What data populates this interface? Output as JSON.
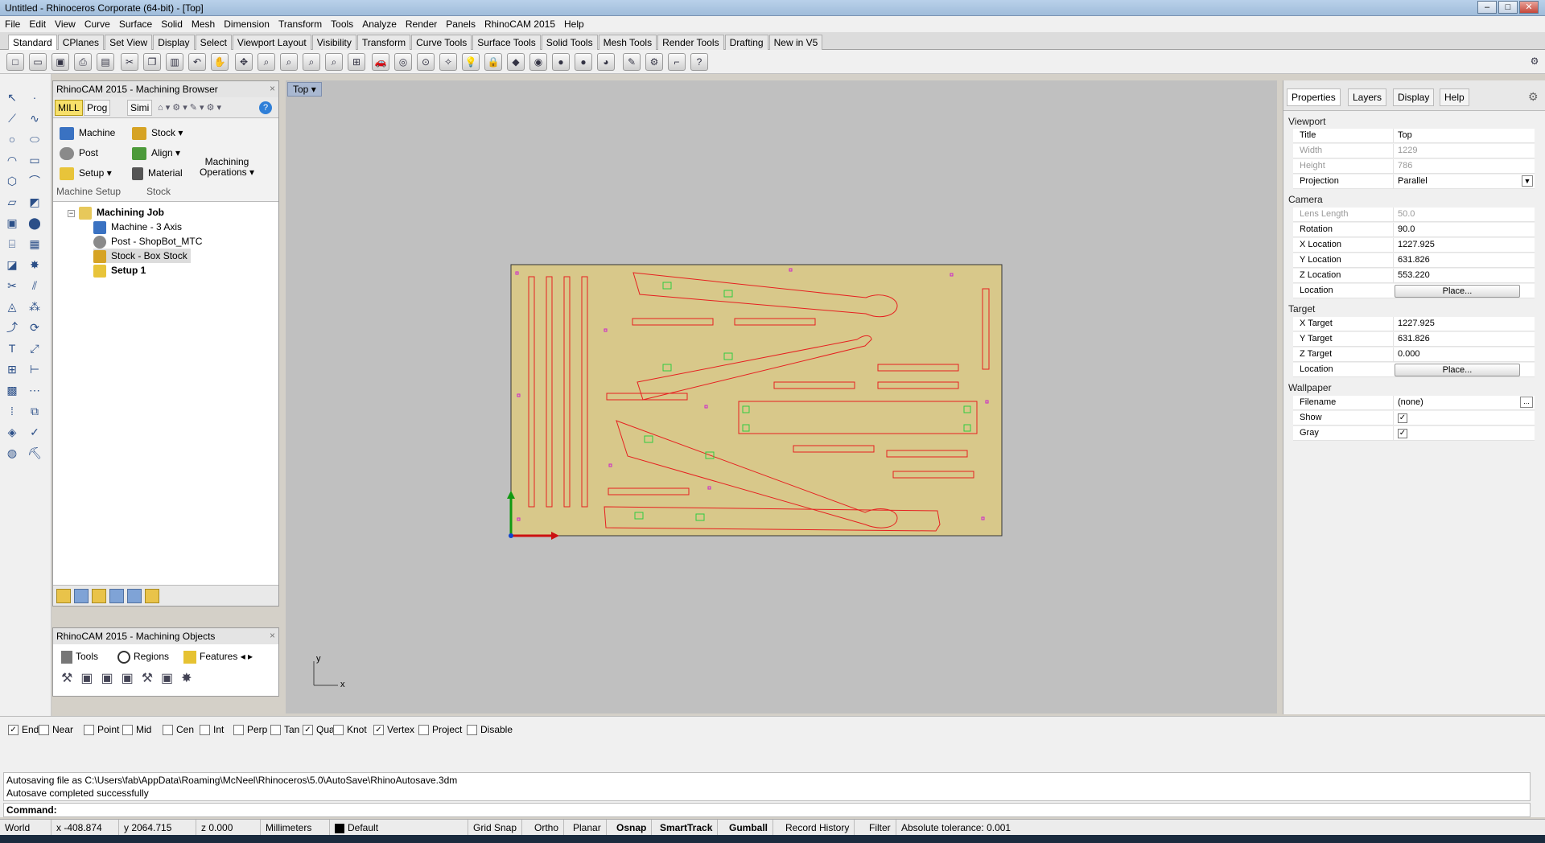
{
  "window": {
    "title": "Untitled - Rhinoceros Corporate (64-bit) - [Top]",
    "controls": [
      "–",
      "□",
      "✕"
    ]
  },
  "menu": [
    "File",
    "Edit",
    "View",
    "Curve",
    "Surface",
    "Solid",
    "Mesh",
    "Dimension",
    "Transform",
    "Tools",
    "Analyze",
    "Render",
    "Panels",
    "RhinoCAM 2015",
    "Help"
  ],
  "tabs": [
    "Standard",
    "CPlanes",
    "Set View",
    "Display",
    "Select",
    "Viewport Layout",
    "Visibility",
    "Transform",
    "Curve Tools",
    "Surface Tools",
    "Solid Tools",
    "Mesh Tools",
    "Render Tools",
    "Drafting",
    "New in V5"
  ],
  "machining_browser": {
    "title": "RhinoCAM 2015 - Machining Browser",
    "tabs": [
      "MILL",
      "Prog",
      "Simi"
    ],
    "ribbon": {
      "machine": "Machine",
      "post": "Post",
      "setup": "Setup",
      "stock": "Stock",
      "align": "Align",
      "material": "Material",
      "operations": "Machining Operations",
      "group_setup": "Machine Setup",
      "group_stock": "Stock"
    },
    "tree": {
      "job": "Machining Job",
      "machine": "Machine - 3 Axis",
      "post": "Post - ShopBot_MTC",
      "stock": "Stock - Box Stock",
      "setup": "Setup 1"
    }
  },
  "machining_objects": {
    "title": "RhinoCAM 2015 - Machining Objects",
    "tabs": [
      "Tools",
      "Regions",
      "Features"
    ]
  },
  "viewport": {
    "label": "Top",
    "axis_y": "y",
    "axis_x": "x"
  },
  "properties": {
    "tabs": [
      "Properties",
      "Layers",
      "Display",
      "Help"
    ],
    "viewport_section": "Viewport",
    "viewport": [
      {
        "k": "Title",
        "v": "Top"
      },
      {
        "k": "Width",
        "v": "1229"
      },
      {
        "k": "Height",
        "v": "786"
      },
      {
        "k": "Projection",
        "v": "Parallel"
      }
    ],
    "camera_section": "Camera",
    "camera": [
      {
        "k": "Lens Length",
        "v": "50.0"
      },
      {
        "k": "Rotation",
        "v": "90.0"
      },
      {
        "k": "X Location",
        "v": "1227.925"
      },
      {
        "k": "Y Location",
        "v": "631.826"
      },
      {
        "k": "Z Location",
        "v": "553.220"
      },
      {
        "k": "Location",
        "v": "Place..."
      }
    ],
    "target_section": "Target",
    "target": [
      {
        "k": "X Target",
        "v": "1227.925"
      },
      {
        "k": "Y Target",
        "v": "631.826"
      },
      {
        "k": "Z Target",
        "v": "0.000"
      },
      {
        "k": "Location",
        "v": "Place..."
      }
    ],
    "wallpaper_section": "Wallpaper",
    "wallpaper": [
      {
        "k": "Filename",
        "v": "(none)"
      },
      {
        "k": "Show",
        "v": ""
      },
      {
        "k": "Gray",
        "v": ""
      }
    ]
  },
  "osnap": [
    {
      "label": "End",
      "checked": true
    },
    {
      "label": "Near",
      "checked": false
    },
    {
      "label": "Point",
      "checked": false
    },
    {
      "label": "Mid",
      "checked": false
    },
    {
      "label": "Cen",
      "checked": false
    },
    {
      "label": "Int",
      "checked": false
    },
    {
      "label": "Perp",
      "checked": false
    },
    {
      "label": "Tan",
      "checked": false
    },
    {
      "label": "Quad",
      "checked": true
    },
    {
      "label": "Knot",
      "checked": false
    },
    {
      "label": "Vertex",
      "checked": true
    },
    {
      "label": "Project",
      "checked": false
    },
    {
      "label": "Disable",
      "checked": false
    }
  ],
  "history": [
    "Autosaving file as C:\\Users\\fab\\AppData\\Roaming\\McNeel\\Rhinoceros\\5.0\\AutoSave\\RhinoAutosave.3dm",
    "Autosave completed successfully"
  ],
  "command_prompt": "Command:",
  "status": {
    "cplane": "World",
    "x": "x -408.874",
    "y": "y 2064.715",
    "z": "z 0.000",
    "units": "Millimeters",
    "layer": "Default",
    "grid_snap": "Grid Snap",
    "ortho": "Ortho",
    "planar": "Planar",
    "osnap": "Osnap",
    "smarttrack": "SmartTrack",
    "gumball": "Gumball",
    "record_history": "Record History",
    "filter": "Filter",
    "tolerance": "Absolute tolerance: 0.001"
  },
  "colors": {
    "stock": "#d8c88a",
    "curve": "#e62020",
    "point": "#cc22cc",
    "accent": "#f7e06a"
  }
}
